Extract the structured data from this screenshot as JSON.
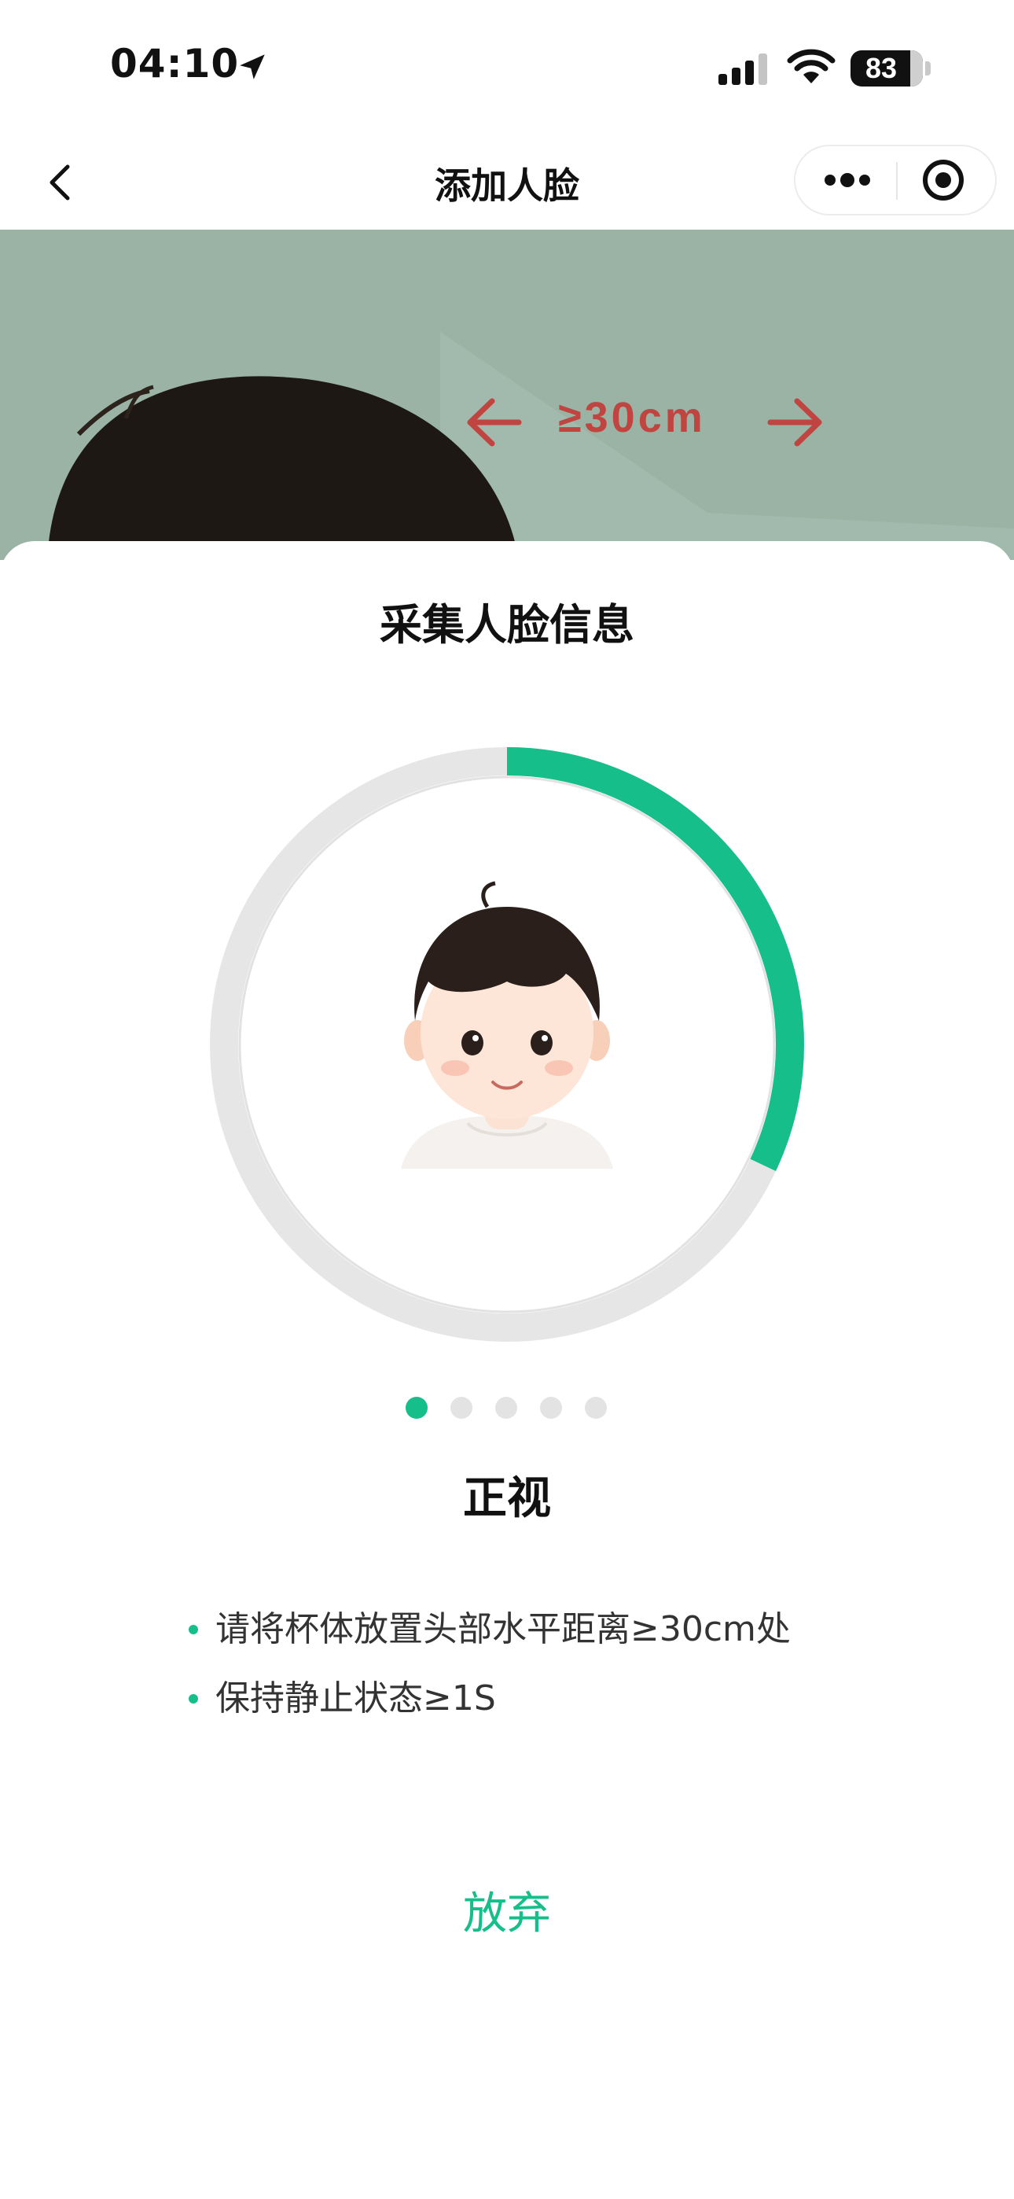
{
  "status_bar": {
    "time": "04:10",
    "battery": "83",
    "icons": [
      "location-arrow-icon",
      "cellular-signal-icon",
      "wifi-icon",
      "battery-icon"
    ]
  },
  "nav": {
    "title": "添加人脸",
    "back_icon": "chevron-left-icon",
    "more_icon": "more-dots-icon",
    "close_icon": "target-close-icon"
  },
  "banner": {
    "distance_hint": "≥30cm"
  },
  "sheet": {
    "title": "采集人脸信息",
    "progress": 0.32,
    "steps_total": 5,
    "step_current": 1,
    "pose_label": "正视",
    "tips": [
      "请将杯体放置头部水平距离≥30cm处",
      "保持静止状态≥1S"
    ],
    "abandon_label": "放弃"
  },
  "colors": {
    "accent": "#16bf8a",
    "banner_bg": "#9ab3a5",
    "hint_red": "#c0443f",
    "ring_track": "#e6e6e6"
  }
}
